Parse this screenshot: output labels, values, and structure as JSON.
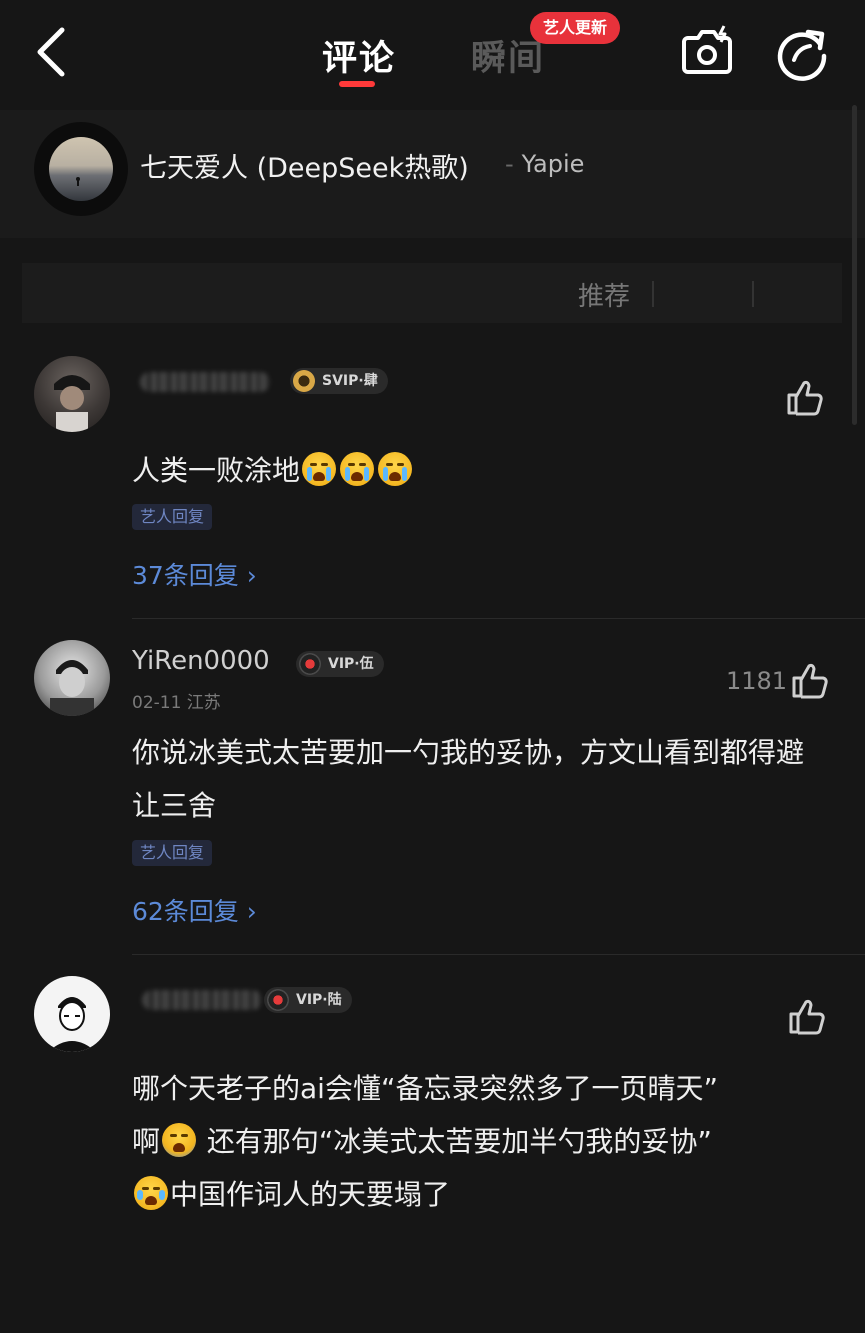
{
  "header": {
    "tabs": [
      {
        "label": "评论"
      },
      {
        "label": "瞬间"
      }
    ],
    "update_badge": "艺人更新"
  },
  "song": {
    "title": "七天爱人 (DeepSeek热歌)",
    "artist": "Yapie"
  },
  "sort": {
    "recommend_label": "推荐"
  },
  "comments": [
    {
      "username": "",
      "vip_label": "SVIP·肆",
      "text": "人类一败涂地",
      "tag": "艺人回复",
      "replies": "37条回复",
      "emoji": [
        "crying-face",
        "crying-face",
        "crying-face"
      ]
    },
    {
      "username": "YiRen0000",
      "vip_label": "VIP·伍",
      "meta": "02-11 江苏",
      "likes": "1181",
      "text": "你说冰美式太苦要加一勺我的妥协，方文山看到都得避让三舍",
      "tag": "艺人回复",
      "replies": "62条回复"
    },
    {
      "username": "",
      "vip_label": "VIP·陆",
      "text_line1": "哪个天老子的ai会懂“备忘录突然多了一页晴天”",
      "text_line2_a": "啊",
      "text_line2_b": "还有那句“冰美式太苦要加半勺我的妥协”",
      "text_line3": "中国作词人的天要塌了",
      "emoji": [
        "screaming-face",
        "laughing-tears-face"
      ]
    }
  ],
  "colors": {
    "background": "#161616",
    "accent_red": "#ff3a3a",
    "reply_link": "#5c8ad8"
  }
}
